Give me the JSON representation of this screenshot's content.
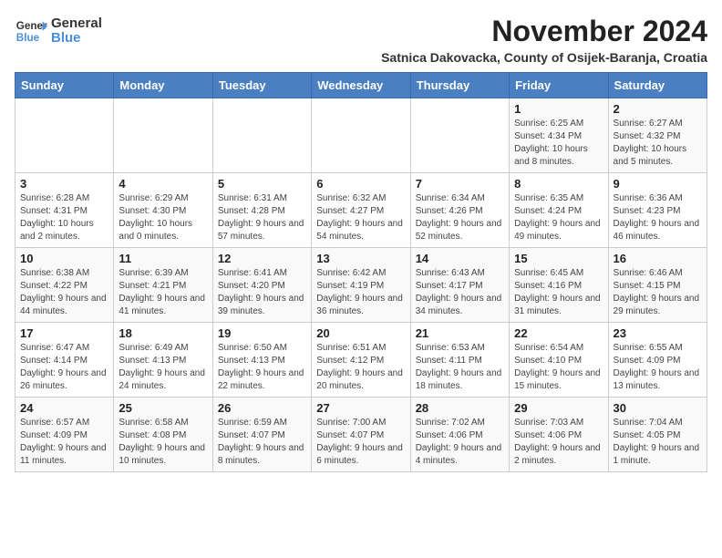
{
  "logo": {
    "general": "General",
    "blue": "Blue"
  },
  "title": "November 2024",
  "subtitle": "Satnica Dakovacka, County of Osijek-Baranja, Croatia",
  "days_of_week": [
    "Sunday",
    "Monday",
    "Tuesday",
    "Wednesday",
    "Thursday",
    "Friday",
    "Saturday"
  ],
  "weeks": [
    [
      {
        "day": "",
        "info": ""
      },
      {
        "day": "",
        "info": ""
      },
      {
        "day": "",
        "info": ""
      },
      {
        "day": "",
        "info": ""
      },
      {
        "day": "",
        "info": ""
      },
      {
        "day": "1",
        "info": "Sunrise: 6:25 AM\nSunset: 4:34 PM\nDaylight: 10 hours and 8 minutes."
      },
      {
        "day": "2",
        "info": "Sunrise: 6:27 AM\nSunset: 4:32 PM\nDaylight: 10 hours and 5 minutes."
      }
    ],
    [
      {
        "day": "3",
        "info": "Sunrise: 6:28 AM\nSunset: 4:31 PM\nDaylight: 10 hours and 2 minutes."
      },
      {
        "day": "4",
        "info": "Sunrise: 6:29 AM\nSunset: 4:30 PM\nDaylight: 10 hours and 0 minutes."
      },
      {
        "day": "5",
        "info": "Sunrise: 6:31 AM\nSunset: 4:28 PM\nDaylight: 9 hours and 57 minutes."
      },
      {
        "day": "6",
        "info": "Sunrise: 6:32 AM\nSunset: 4:27 PM\nDaylight: 9 hours and 54 minutes."
      },
      {
        "day": "7",
        "info": "Sunrise: 6:34 AM\nSunset: 4:26 PM\nDaylight: 9 hours and 52 minutes."
      },
      {
        "day": "8",
        "info": "Sunrise: 6:35 AM\nSunset: 4:24 PM\nDaylight: 9 hours and 49 minutes."
      },
      {
        "day": "9",
        "info": "Sunrise: 6:36 AM\nSunset: 4:23 PM\nDaylight: 9 hours and 46 minutes."
      }
    ],
    [
      {
        "day": "10",
        "info": "Sunrise: 6:38 AM\nSunset: 4:22 PM\nDaylight: 9 hours and 44 minutes."
      },
      {
        "day": "11",
        "info": "Sunrise: 6:39 AM\nSunset: 4:21 PM\nDaylight: 9 hours and 41 minutes."
      },
      {
        "day": "12",
        "info": "Sunrise: 6:41 AM\nSunset: 4:20 PM\nDaylight: 9 hours and 39 minutes."
      },
      {
        "day": "13",
        "info": "Sunrise: 6:42 AM\nSunset: 4:19 PM\nDaylight: 9 hours and 36 minutes."
      },
      {
        "day": "14",
        "info": "Sunrise: 6:43 AM\nSunset: 4:17 PM\nDaylight: 9 hours and 34 minutes."
      },
      {
        "day": "15",
        "info": "Sunrise: 6:45 AM\nSunset: 4:16 PM\nDaylight: 9 hours and 31 minutes."
      },
      {
        "day": "16",
        "info": "Sunrise: 6:46 AM\nSunset: 4:15 PM\nDaylight: 9 hours and 29 minutes."
      }
    ],
    [
      {
        "day": "17",
        "info": "Sunrise: 6:47 AM\nSunset: 4:14 PM\nDaylight: 9 hours and 26 minutes."
      },
      {
        "day": "18",
        "info": "Sunrise: 6:49 AM\nSunset: 4:13 PM\nDaylight: 9 hours and 24 minutes."
      },
      {
        "day": "19",
        "info": "Sunrise: 6:50 AM\nSunset: 4:13 PM\nDaylight: 9 hours and 22 minutes."
      },
      {
        "day": "20",
        "info": "Sunrise: 6:51 AM\nSunset: 4:12 PM\nDaylight: 9 hours and 20 minutes."
      },
      {
        "day": "21",
        "info": "Sunrise: 6:53 AM\nSunset: 4:11 PM\nDaylight: 9 hours and 18 minutes."
      },
      {
        "day": "22",
        "info": "Sunrise: 6:54 AM\nSunset: 4:10 PM\nDaylight: 9 hours and 15 minutes."
      },
      {
        "day": "23",
        "info": "Sunrise: 6:55 AM\nSunset: 4:09 PM\nDaylight: 9 hours and 13 minutes."
      }
    ],
    [
      {
        "day": "24",
        "info": "Sunrise: 6:57 AM\nSunset: 4:09 PM\nDaylight: 9 hours and 11 minutes."
      },
      {
        "day": "25",
        "info": "Sunrise: 6:58 AM\nSunset: 4:08 PM\nDaylight: 9 hours and 10 minutes."
      },
      {
        "day": "26",
        "info": "Sunrise: 6:59 AM\nSunset: 4:07 PM\nDaylight: 9 hours and 8 minutes."
      },
      {
        "day": "27",
        "info": "Sunrise: 7:00 AM\nSunset: 4:07 PM\nDaylight: 9 hours and 6 minutes."
      },
      {
        "day": "28",
        "info": "Sunrise: 7:02 AM\nSunset: 4:06 PM\nDaylight: 9 hours and 4 minutes."
      },
      {
        "day": "29",
        "info": "Sunrise: 7:03 AM\nSunset: 4:06 PM\nDaylight: 9 hours and 2 minutes."
      },
      {
        "day": "30",
        "info": "Sunrise: 7:04 AM\nSunset: 4:05 PM\nDaylight: 9 hours and 1 minute."
      }
    ]
  ]
}
